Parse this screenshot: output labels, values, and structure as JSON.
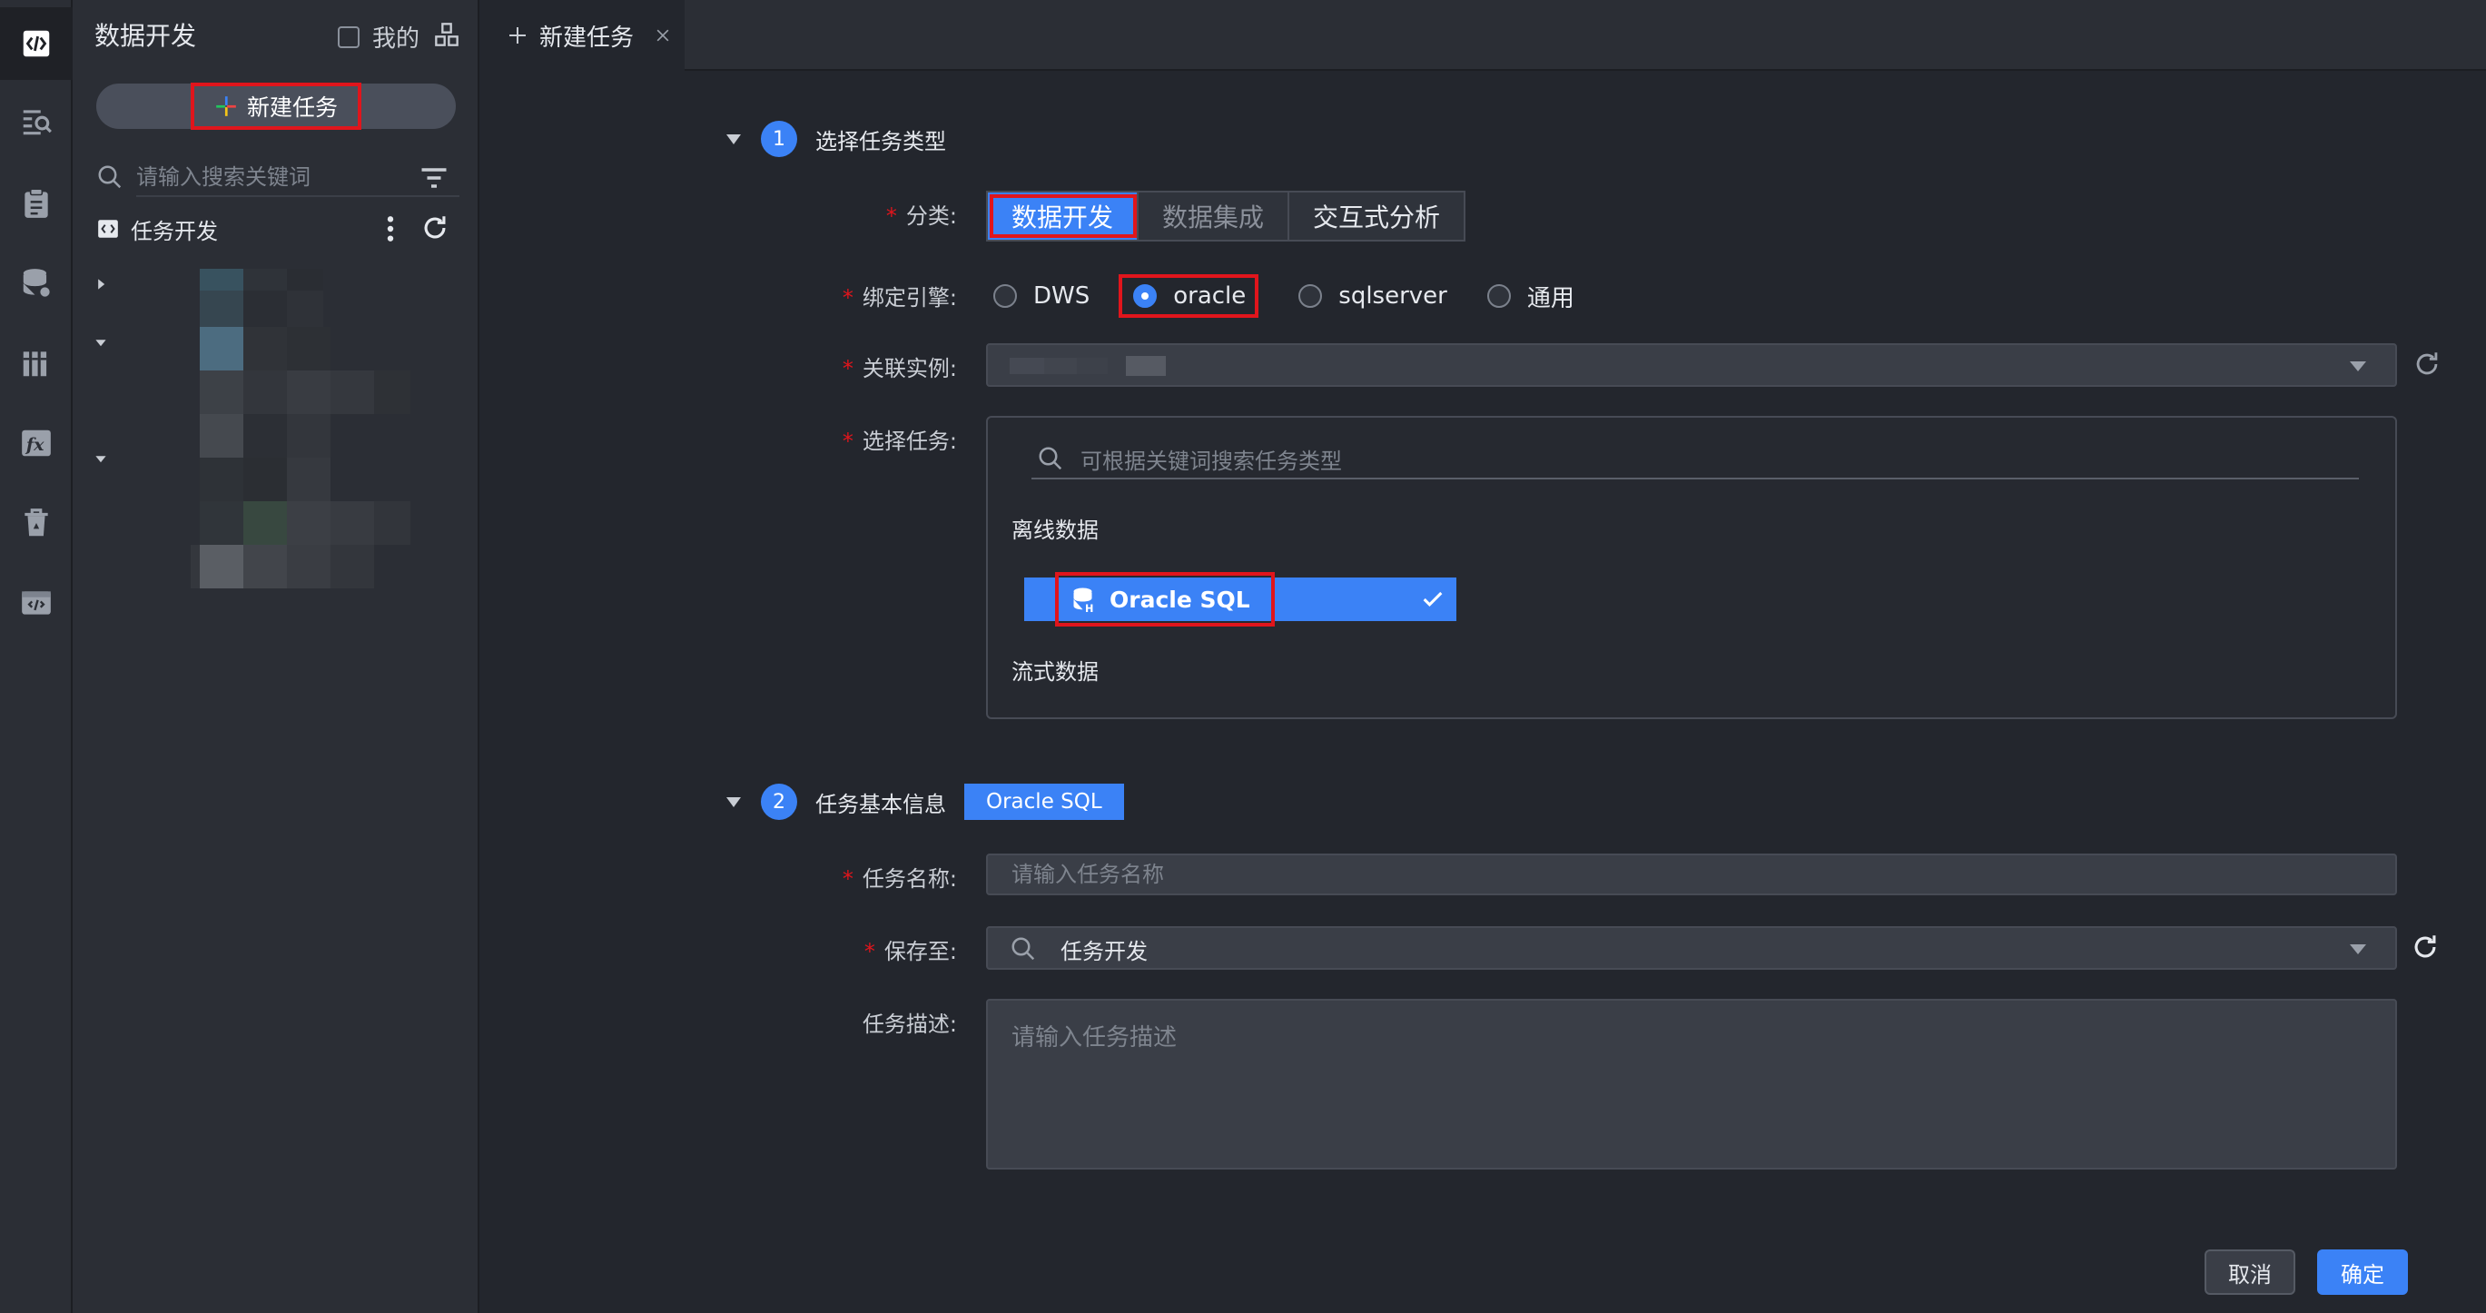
{
  "sidebar": {
    "title": "数据开发",
    "mine_label": "我的",
    "new_task_label": "新建任务",
    "search_placeholder": "请输入搜索关键词",
    "tree_root_label": "任务开发"
  },
  "tabs": [
    {
      "label": "新建任务"
    }
  ],
  "section1": {
    "step": "1",
    "title": "选择任务类型",
    "category_label": "分类:",
    "categories": [
      "数据开发",
      "数据集成",
      "交互式分析"
    ],
    "selected_category": "数据开发",
    "engine_label": "绑定引擎:",
    "engines": [
      "DWS",
      "oracle",
      "sqlserver",
      "通用"
    ],
    "selected_engine": "oracle",
    "instance_label": "关联实例:",
    "select_task_label": "选择任务:",
    "task_search_placeholder": "可根据关键词搜索任务类型",
    "group_offline": "离线数据",
    "selected_task": "Oracle SQL",
    "group_stream": "流式数据"
  },
  "section2": {
    "step": "2",
    "title": "任务基本信息",
    "badge": "Oracle SQL",
    "name_label": "任务名称:",
    "name_placeholder": "请输入任务名称",
    "save_label": "保存至:",
    "save_value": "任务开发",
    "desc_label": "任务描述:",
    "desc_placeholder": "请输入任务描述"
  },
  "actions": {
    "cancel": "取消",
    "confirm": "确定"
  },
  "colors": {
    "accent": "#3b82f6",
    "highlight": "#e0151c",
    "required": "#e0151c"
  }
}
